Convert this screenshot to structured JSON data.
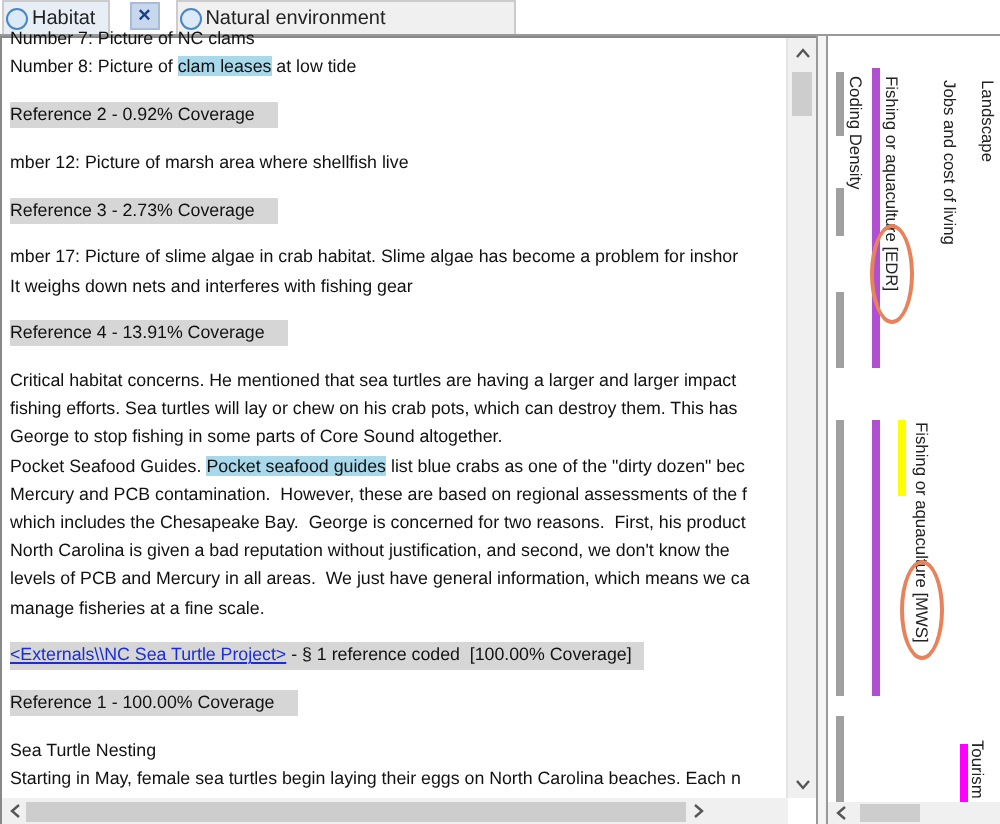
{
  "tabs": [
    {
      "label": "Habitat",
      "selected": true
    },
    {
      "label": "Natural environment",
      "selected": false
    }
  ],
  "close_button": {
    "label": "×"
  },
  "document": {
    "lines": [
      {
        "kind": "text",
        "parts": [
          {
            "text": "Number 7: Picture of NC clams",
            "highlighted": false
          }
        ]
      },
      {
        "kind": "text",
        "parts": [
          {
            "text": "Number 8: Picture of ",
            "highlighted": false
          },
          {
            "text": "clam leases",
            "highlighted": true
          },
          {
            "text": " at low tide",
            "highlighted": false
          }
        ]
      },
      {
        "kind": "blank"
      },
      {
        "kind": "reference",
        "parts": [
          {
            "text": "Reference 2 - 0.92% Coverage",
            "highlighted": false
          }
        ]
      },
      {
        "kind": "blank"
      },
      {
        "kind": "text",
        "parts": [
          {
            "text": "mber 12: Picture of marsh area where shellfish live",
            "highlighted": false
          }
        ]
      },
      {
        "kind": "blank"
      },
      {
        "kind": "reference",
        "parts": [
          {
            "text": "Reference 3 - 2.73% Coverage",
            "highlighted": false
          }
        ]
      },
      {
        "kind": "blank"
      },
      {
        "kind": "text",
        "parts": [
          {
            "text": "mber 17: Picture of slime algae in crab habitat. Slime algae has become a problem for inshor",
            "highlighted": false
          }
        ]
      },
      {
        "kind": "text",
        "parts": [
          {
            "text": "It weighs down nets and interferes with fishing gear",
            "highlighted": false
          }
        ]
      },
      {
        "kind": "blank"
      },
      {
        "kind": "reference",
        "parts": [
          {
            "text": "Reference 4 - 13.91% Coverage",
            "highlighted": false
          }
        ]
      },
      {
        "kind": "blank"
      },
      {
        "kind": "text",
        "parts": [
          {
            "text": "Critical habitat concerns. He mentioned that sea turtles are having a larger and larger impact",
            "highlighted": false
          }
        ]
      },
      {
        "kind": "text",
        "parts": [
          {
            "text": "fishing efforts. Sea turtles will lay or chew on his crab pots, which can destroy them. This has",
            "highlighted": false
          }
        ]
      },
      {
        "kind": "text",
        "parts": [
          {
            "text": "George to stop fishing in some parts of Core Sound altogether.",
            "highlighted": false
          }
        ]
      },
      {
        "kind": "text",
        "parts": [
          {
            "text": "Pocket Seafood Guides. ",
            "highlighted": false
          },
          {
            "text": "Pocket seafood guides",
            "highlighted": true
          },
          {
            "text": " list blue crabs as one of the \"dirty dozen\" bec",
            "highlighted": false
          }
        ]
      },
      {
        "kind": "text",
        "parts": [
          {
            "text": "Mercury and PCB contamination.  However, these are based on regional assessments of the f",
            "highlighted": false
          }
        ]
      },
      {
        "kind": "text",
        "parts": [
          {
            "text": "which includes the Chesapeake Bay.  George is concerned for two reasons.  First, his product",
            "highlighted": false
          }
        ]
      },
      {
        "kind": "text",
        "parts": [
          {
            "text": "North Carolina is given a bad reputation without justification, and second, we don't know the",
            "highlighted": false
          }
        ]
      },
      {
        "kind": "text",
        "parts": [
          {
            "text": "levels of PCB and Mercury in all areas.  We just have general information, which means we ca",
            "highlighted": false
          }
        ]
      },
      {
        "kind": "text",
        "parts": [
          {
            "text": "manage fisheries at a fine scale.",
            "highlighted": false
          }
        ]
      },
      {
        "kind": "blank"
      },
      {
        "kind": "source",
        "link": "<Externals\\\\NC Sea Turtle Project>",
        "text": " - § 1 reference coded  [100.00% Coverage]"
      },
      {
        "kind": "blank"
      },
      {
        "kind": "reference",
        "parts": [
          {
            "text": "Reference 1 - 100.00% Coverage",
            "highlighted": false
          }
        ]
      },
      {
        "kind": "blank"
      },
      {
        "kind": "text",
        "parts": [
          {
            "text": "Sea Turtle Nesting",
            "highlighted": false
          }
        ]
      },
      {
        "kind": "text",
        "parts": [
          {
            "text": "Starting in May, female sea turtles begin laying their eggs on North Carolina beaches. Each n",
            "highlighted": false
          }
        ]
      }
    ]
  },
  "coding_stripes": [
    {
      "label": "Coding Density",
      "kind": "density",
      "color": "#a0a0a0"
    },
    {
      "label": "Fishing or aquaculture [EDR]",
      "kind": "stripe",
      "color": "#b050d0",
      "annotated": true
    },
    {
      "label": "Jobs and cost of living",
      "kind": "label"
    },
    {
      "label": "Landscape",
      "kind": "label"
    },
    {
      "label": "Fishing or aquaculture [MWS]",
      "kind": "stripe",
      "color": "#ffff00",
      "annotated": true
    },
    {
      "label": "Tourism",
      "kind": "stripe",
      "color": "#ff00ff"
    }
  ]
}
